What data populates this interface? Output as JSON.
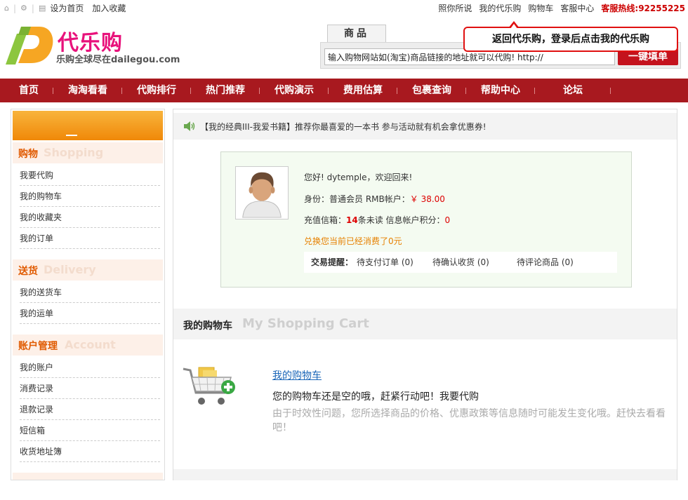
{
  "topbar": {
    "home_icon": "home-icon",
    "left_links": [
      "设为首页",
      "加入收藏"
    ],
    "right_links": [
      "照你所说",
      "我的代乐购",
      "购物车",
      "客服中心"
    ],
    "hotline": "客服热线:92255225"
  },
  "logo": {
    "name": "代乐购",
    "slogan": "乐购全球尽在dailegou.com"
  },
  "search": {
    "tab_label": "商品",
    "placeholder": "输入购物网站如(淘宝)商品链接的地址就可以代购! http://",
    "value": "输入购物网站如(淘宝)商品链接的地址就可以代购! http://",
    "button_label": "一键填单"
  },
  "callout": {
    "text": "返回代乐购，登录后点击我的代乐购"
  },
  "nav": {
    "items": [
      "首页",
      "淘淘看看",
      "代购排行",
      "热门推荐",
      "代购演示",
      "费用估算",
      "包裹查询",
      "帮助中心",
      "论坛"
    ]
  },
  "sidebar": {
    "sections": [
      {
        "cn": "购物",
        "en": "Shopping",
        "links": [
          "我要代购",
          "我的购物车",
          "我的收藏夹",
          "我的订单"
        ]
      },
      {
        "cn": "送货",
        "en": "Delivery",
        "links": [
          "我的送货车",
          "我的运单"
        ]
      },
      {
        "cn": "账户管理",
        "en": "Account",
        "links": [
          "我的账户",
          "消费记录",
          "退款记录",
          "短信箱",
          "收货地址簿"
        ]
      }
    ]
  },
  "notice": {
    "text": "【我的经典III-我爱书籍】推荐你最喜爱的一本书 参与活动就有机会拿优惠券!"
  },
  "user": {
    "greeting": "您好! dytemple，欢迎回来!",
    "identity_label": "身份：普通会员 RMB帐户：",
    "balance": "￥ 38.00",
    "mailbox_label": "充值信箱：",
    "unread_count": "14",
    "unread_suffix": "条未读 信息帐户积分：",
    "points": "0",
    "consumed": "兑换您当前已经消费了0元",
    "trade_label": "交易提醒：",
    "pending_pay": "待支付订单 (0)",
    "pending_receive": "待确认收货 (0)",
    "pending_review": "待评论商品 (0)"
  },
  "cart": {
    "title_cn": "我的购物车",
    "title_en": "My Shopping Cart",
    "link": "我的购物车",
    "message": "您的购物车还是空的哦，赶紧行动吧！我要代购",
    "note": "由于时效性问题，您所选择商品的价格、优惠政策等信息随时可能发生变化哦。赶快去看看吧！"
  }
}
